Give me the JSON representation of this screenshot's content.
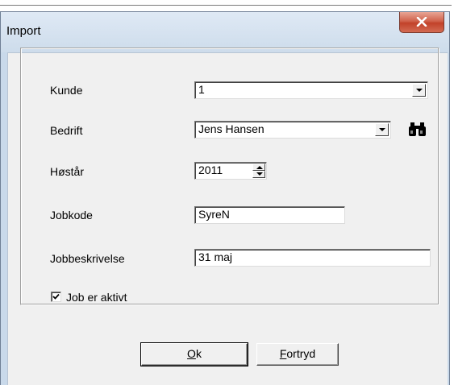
{
  "window": {
    "title": "Import"
  },
  "form": {
    "kunde": {
      "label": "Kunde",
      "value": "1"
    },
    "bedrift": {
      "label": "Bedrift",
      "value": "Jens Hansen"
    },
    "hoestaar": {
      "label": "Høstår",
      "value": "2011"
    },
    "jobkode": {
      "label": "Jobkode",
      "value": "SyreN"
    },
    "jobbeskrivelse": {
      "label": "Jobbeskrivelse",
      "value": "31 maj"
    },
    "job_aktiv": {
      "label": "Job er aktivt",
      "checked": true
    }
  },
  "buttons": {
    "ok": {
      "mnemonic": "O",
      "rest": "k"
    },
    "fortryd": {
      "mnemonic": "F",
      "rest": "ortryd"
    }
  },
  "icons": {
    "close": "close-icon",
    "search": "binoculars-icon"
  },
  "colors": {
    "close_button": "#c2422a",
    "title_bar": "#cddceb",
    "dialog_face": "#f0f0f0"
  }
}
